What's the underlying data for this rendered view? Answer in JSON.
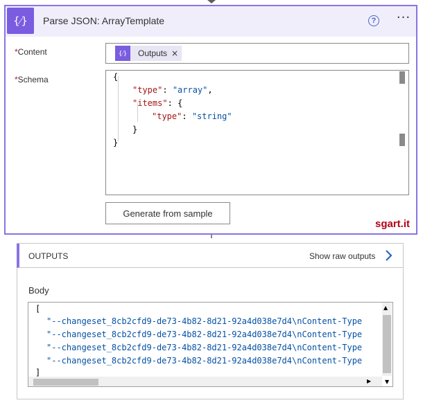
{
  "action": {
    "icon_glyph": "{⁄}",
    "title": "Parse JSON: ArrayTemplate",
    "help_glyph": "?",
    "more_glyph": "···"
  },
  "fields": {
    "required_mark": "*",
    "content_label": "Content",
    "schema_label": "Schema",
    "token_glyph": "{⁄}",
    "token_label": "Outputs",
    "token_remove": "×"
  },
  "schema_code": {
    "l1": "{",
    "l2_key": "\"type\"",
    "l2_sep": ": ",
    "l2_val": "\"array\"",
    "l2_end": ",",
    "l3_key": "\"items\"",
    "l3_end": ": {",
    "l4_key": "\"type\"",
    "l4_sep": ": ",
    "l4_val": "\"string\"",
    "l5": "}",
    "l6": "}"
  },
  "buttons": {
    "generate": "Generate from sample"
  },
  "watermark": "sgart.it",
  "outputs": {
    "title": "OUTPUTS",
    "raw_link": "Show raw outputs",
    "body_label": "Body",
    "open_bracket": "[",
    "close_bracket": "]",
    "lines": [
      "\"--changeset_8cb2cfd9-de73-4b82-8d21-92a4d038e7d4\\nContent-Type",
      "\"--changeset_8cb2cfd9-de73-4b82-8d21-92a4d038e7d4\\nContent-Type",
      "\"--changeset_8cb2cfd9-de73-4b82-8d21-92a4d038e7d4\\nContent-Type",
      "\"--changeset_8cb2cfd9-de73-4b82-8d21-92a4d038e7d4\\nContent-Type"
    ]
  },
  "colors": {
    "accent": "#7a5ce0",
    "border_accent": "#8a73e2",
    "header_bg": "#f1eefc",
    "json_key": "#a31515",
    "json_string": "#0451a5",
    "watermark": "#b3001b"
  }
}
